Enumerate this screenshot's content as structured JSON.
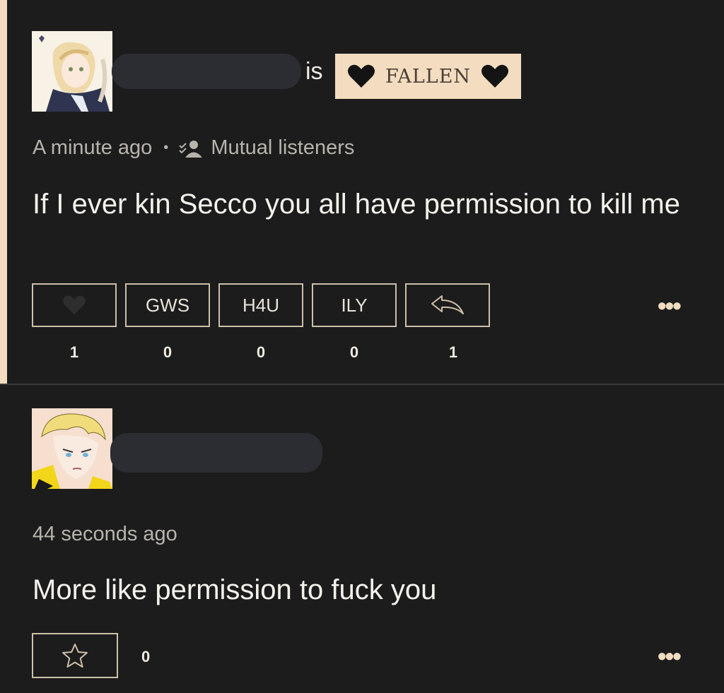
{
  "post": {
    "status_word": "is",
    "mood": "FALLEN",
    "timestamp": "A minute ago",
    "separator": "•",
    "audience": "Mutual listeners",
    "text": "If I ever kin Secco you all have permission to kill me",
    "reactions": [
      {
        "label": "",
        "icon": "heart-icon",
        "count": "1"
      },
      {
        "label": "GWS",
        "count": "0"
      },
      {
        "label": "H4U",
        "count": "0"
      },
      {
        "label": "ILY",
        "count": "0"
      },
      {
        "label": "",
        "icon": "reply-icon",
        "count": "1"
      }
    ],
    "more": "•••"
  },
  "reply": {
    "timestamp": "44 seconds ago",
    "text": "More like permission to fuck you",
    "star_count": "0",
    "more": "•••"
  },
  "colors": {
    "background": "#1c1c1c",
    "accent": "#f3dcc0",
    "border": "#cdbfa9"
  }
}
